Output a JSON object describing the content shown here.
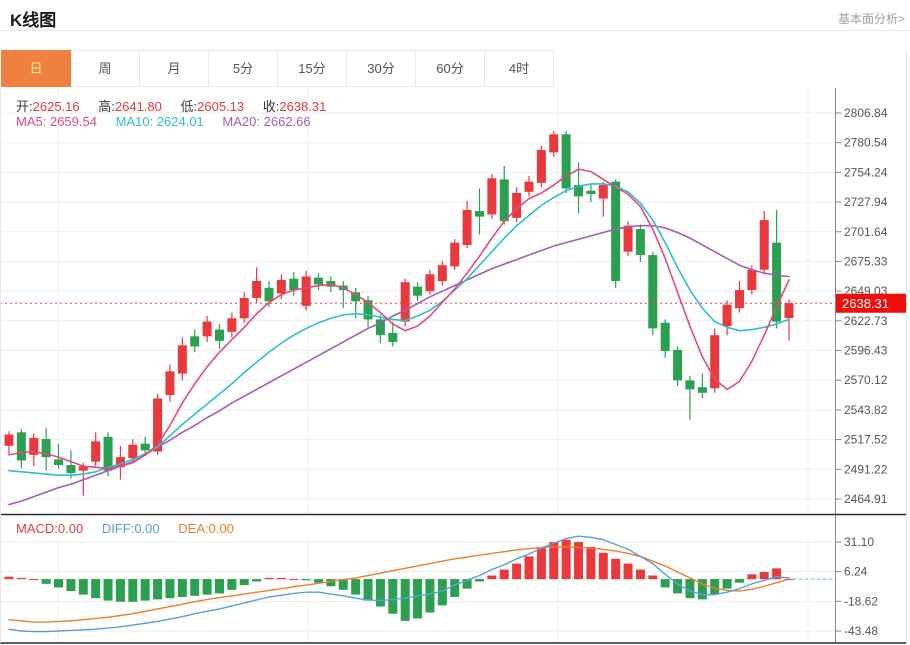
{
  "header": {
    "title": "K线图",
    "link": "基本面分析>"
  },
  "tabs": {
    "items": [
      "日",
      "周",
      "月",
      "5分",
      "15分",
      "30分",
      "60分",
      "4时"
    ],
    "active_index": 0
  },
  "legend": {
    "open_label": "开:",
    "open": "2625.16",
    "high_label": "高:",
    "high": "2641.80",
    "low_label": "低:",
    "low": "2605.13",
    "close_label": "收:",
    "close": "2638.31",
    "ma5_label": "MA5:",
    "ma5": "2659.54",
    "ma10_label": "MA10:",
    "ma10": "2624.01",
    "ma20_label": "MA20:",
    "ma20": "2662.66"
  },
  "macd_legend": {
    "macd_label": "MACD:",
    "macd": "0.00",
    "diff_label": "DIFF:",
    "diff": "0.00",
    "dea_label": "DEA:",
    "dea": "0.00"
  },
  "price_tag": "2638.31",
  "colors": {
    "up": "#e8393d",
    "down": "#2aa050",
    "ma5": "#e9477e",
    "ma10": "#2cc0ce",
    "ma20": "#a55cb8",
    "diff": "#579fdf",
    "dea": "#ef7e28",
    "tag_bg": "#f20d0d",
    "tag_text": "#ffffff",
    "dotted_close": "#f23b3b",
    "dashed_zero": "#7fcbe4",
    "tab_active_bg": "#ef8040",
    "tab_active_text": "#ffeaa7",
    "grid": "#ededed",
    "axis": "#8a8a8a",
    "frame": "#2b2b2b",
    "tick_text": "#555555"
  },
  "chart_data": {
    "type": "candlestick+macd",
    "main": {
      "title": "K线图 日线",
      "y_ticks": [
        2806.84,
        2780.54,
        2754.24,
        2727.94,
        2701.64,
        2675.33,
        2649.03,
        2622.73,
        2596.43,
        2570.12,
        2543.82,
        2517.52,
        2491.22,
        2464.91
      ],
      "ylim": [
        2464.91,
        2806.84
      ],
      "last_close": 2638.31,
      "grid": true,
      "candles_ohlc": [
        [
          2512,
          2525,
          2504,
          2522
        ],
        [
          2524,
          2527,
          2492,
          2499
        ],
        [
          2504,
          2523,
          2494,
          2519
        ],
        [
          2518,
          2528,
          2490,
          2502
        ],
        [
          2500,
          2514,
          2492,
          2495
        ],
        [
          2495,
          2508,
          2483,
          2488
        ],
        [
          2490,
          2497,
          2468,
          2494
        ],
        [
          2498,
          2524,
          2494,
          2516
        ],
        [
          2520,
          2524,
          2485,
          2490
        ],
        [
          2493,
          2512,
          2482,
          2502
        ],
        [
          2501,
          2518,
          2497,
          2513
        ],
        [
          2514,
          2520,
          2503,
          2508
        ],
        [
          2507,
          2558,
          2504,
          2554
        ],
        [
          2557,
          2584,
          2551,
          2578
        ],
        [
          2576,
          2608,
          2570,
          2601
        ],
        [
          2609,
          2615,
          2595,
          2600
        ],
        [
          2609,
          2627,
          2604,
          2622
        ],
        [
          2615,
          2620,
          2598,
          2605
        ],
        [
          2613,
          2630,
          2608,
          2625
        ],
        [
          2625,
          2648,
          2621,
          2643
        ],
        [
          2643,
          2670,
          2639,
          2658
        ],
        [
          2652,
          2658,
          2635,
          2640
        ],
        [
          2647,
          2664,
          2642,
          2659
        ],
        [
          2660,
          2666,
          2645,
          2650
        ],
        [
          2636,
          2667,
          2632,
          2662
        ],
        [
          2661,
          2665,
          2650,
          2655
        ],
        [
          2658,
          2662,
          2648,
          2653
        ],
        [
          2654,
          2658,
          2634,
          2650
        ],
        [
          2648,
          2652,
          2625,
          2640
        ],
        [
          2641,
          2645,
          2617,
          2624
        ],
        [
          2624,
          2628,
          2603,
          2610
        ],
        [
          2612,
          2622,
          2600,
          2604
        ],
        [
          2622,
          2660,
          2618,
          2657
        ],
        [
          2653,
          2657,
          2640,
          2645
        ],
        [
          2649,
          2668,
          2646,
          2664
        ],
        [
          2658,
          2676,
          2654,
          2672
        ],
        [
          2671,
          2695,
          2668,
          2692
        ],
        [
          2690,
          2729,
          2687,
          2721
        ],
        [
          2720,
          2740,
          2699,
          2715
        ],
        [
          2717,
          2753,
          2713,
          2749
        ],
        [
          2748,
          2760,
          2708,
          2711
        ],
        [
          2714,
          2741,
          2710,
          2736
        ],
        [
          2737,
          2751,
          2733,
          2746
        ],
        [
          2745,
          2778,
          2741,
          2774
        ],
        [
          2772,
          2791,
          2768,
          2788
        ],
        [
          2788,
          2791,
          2736,
          2740
        ],
        [
          2743,
          2763,
          2718,
          2733
        ],
        [
          2738,
          2744,
          2728,
          2735
        ],
        [
          2731,
          2746,
          2715,
          2743
        ],
        [
          2746,
          2748,
          2652,
          2658
        ],
        [
          2684,
          2711,
          2680,
          2707
        ],
        [
          2704,
          2708,
          2675,
          2681
        ],
        [
          2681,
          2684,
          2610,
          2616
        ],
        [
          2621,
          2624,
          2590,
          2596
        ],
        [
          2597,
          2600,
          2565,
          2570
        ],
        [
          2570,
          2574,
          2535,
          2562
        ],
        [
          2564,
          2576,
          2554,
          2559
        ],
        [
          2563,
          2616,
          2559,
          2610
        ],
        [
          2618,
          2641,
          2610,
          2637
        ],
        [
          2634,
          2658,
          2630,
          2650
        ],
        [
          2650,
          2672,
          2646,
          2668
        ],
        [
          2668,
          2720,
          2664,
          2712
        ],
        [
          2692,
          2721,
          2616,
          2622
        ],
        [
          2625.16,
          2641.8,
          2605.13,
          2638.31
        ]
      ],
      "ma5": [
        2504,
        2506,
        2507,
        2505,
        2502,
        2498,
        2494,
        2493,
        2492,
        2494,
        2497,
        2504,
        2513,
        2530,
        2550,
        2567,
        2582,
        2595,
        2606,
        2617,
        2629,
        2639,
        2646,
        2650,
        2652,
        2654,
        2655,
        2652,
        2646,
        2639,
        2630,
        2620,
        2614,
        2618,
        2627,
        2639,
        2651,
        2665,
        2680,
        2696,
        2711,
        2722,
        2731,
        2736,
        2743,
        2751,
        2757,
        2755,
        2748,
        2741,
        2735,
        2724,
        2704,
        2678,
        2648,
        2618,
        2591,
        2571,
        2562,
        2569,
        2587,
        2610,
        2635,
        2659
      ],
      "ma10": [
        2490,
        2489,
        2488,
        2487,
        2486,
        2486,
        2487,
        2489,
        2493,
        2496,
        2500,
        2505,
        2511,
        2521,
        2531,
        2540,
        2549,
        2558,
        2567,
        2577,
        2586,
        2595,
        2603,
        2610,
        2616,
        2621,
        2625,
        2628,
        2629,
        2628,
        2626,
        2624,
        2623,
        2627,
        2632,
        2640,
        2650,
        2660,
        2672,
        2684,
        2696,
        2707,
        2716,
        2725,
        2732,
        2738,
        2742,
        2744,
        2744,
        2742,
        2737,
        2727,
        2712,
        2692,
        2670,
        2650,
        2634,
        2622,
        2617,
        2614,
        2615,
        2617,
        2620,
        2624
      ],
      "ma20": [
        2460,
        2463,
        2467,
        2471,
        2475,
        2478,
        2482,
        2486,
        2490,
        2494,
        2498,
        2504,
        2511,
        2517,
        2524,
        2530,
        2537,
        2543,
        2550,
        2556,
        2562,
        2568,
        2574,
        2580,
        2586,
        2592,
        2598,
        2604,
        2610,
        2616,
        2621,
        2627,
        2632,
        2638,
        2644,
        2649,
        2654,
        2659,
        2664,
        2669,
        2673,
        2677,
        2681,
        2685,
        2689,
        2692,
        2695,
        2698,
        2701,
        2704,
        2706,
        2707,
        2707,
        2705,
        2701,
        2696,
        2690,
        2684,
        2678,
        2672,
        2668,
        2665,
        2663,
        2662
      ]
    },
    "macd": {
      "y_ticks": [
        31.1,
        6.24,
        -18.62,
        -43.48
      ],
      "histogram": [
        2,
        1,
        0,
        -4,
        -7,
        -10,
        -13,
        -16,
        -18,
        -19,
        -19,
        -18,
        -17,
        -16,
        -15,
        -14,
        -13,
        -12,
        -9,
        -5,
        -2,
        1,
        1,
        0,
        -1,
        -3,
        -6,
        -9,
        -13,
        -18,
        -23,
        -29,
        -35,
        -33,
        -28,
        -22,
        -15,
        -8,
        -2,
        3,
        8,
        13,
        19,
        26,
        31,
        33,
        31,
        27,
        22,
        17,
        13,
        8,
        3,
        -7,
        -12,
        -16,
        -17,
        -13,
        -8,
        -3,
        4,
        6,
        9,
        0
      ],
      "diff": [
        -42,
        -43.5,
        -44,
        -44,
        -43.5,
        -43,
        -42.5,
        -42,
        -41,
        -40,
        -38.5,
        -37,
        -35.5,
        -33.5,
        -31.5,
        -29,
        -27,
        -25,
        -22.5,
        -20,
        -17.5,
        -15,
        -13.5,
        -12,
        -11,
        -11,
        -12.5,
        -14,
        -16,
        -17.5,
        -18,
        -17,
        -16,
        -14,
        -12.5,
        -10,
        -5,
        -1,
        3,
        8,
        12,
        17,
        21,
        26,
        30,
        34,
        36,
        35,
        33,
        29,
        25,
        19,
        13,
        4,
        -4,
        -10,
        -13,
        -13,
        -11,
        -8,
        -4,
        -1,
        2,
        1
      ],
      "dea": [
        -34,
        -35,
        -36,
        -36,
        -35.5,
        -35,
        -34,
        -33,
        -32,
        -30.5,
        -29,
        -27,
        -25,
        -23,
        -21,
        -19,
        -17,
        -15.5,
        -14,
        -12.5,
        -11,
        -9.5,
        -8,
        -6.5,
        -5,
        -3.5,
        -2,
        -0.5,
        1,
        3,
        5,
        7,
        9,
        11,
        13,
        15,
        17,
        18.5,
        20,
        21.5,
        23,
        24.5,
        25.5,
        26.5,
        27,
        27,
        26.5,
        26,
        25,
        23.5,
        21.5,
        19,
        15,
        11,
        6,
        1,
        -4,
        -7.5,
        -9.5,
        -10,
        -8.5,
        -6,
        -3,
        0
      ]
    }
  }
}
